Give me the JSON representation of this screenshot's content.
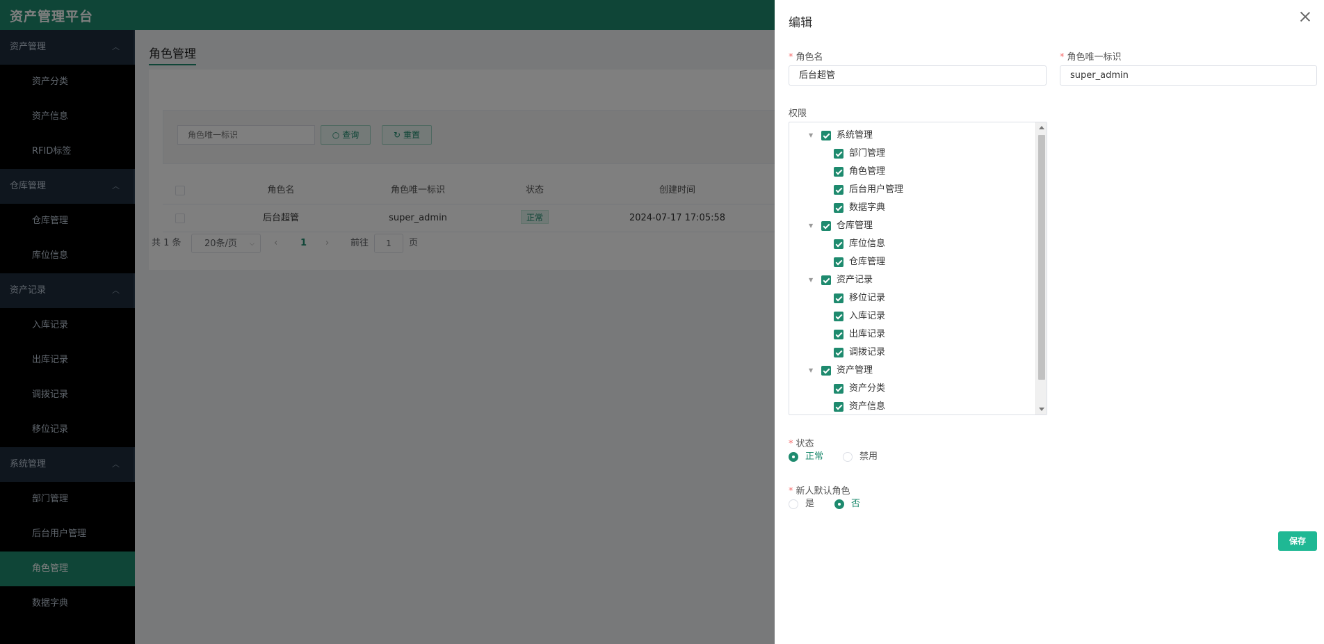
{
  "app": {
    "title": "资产管理平台"
  },
  "sidebar": {
    "groups": [
      {
        "label": "资产管理",
        "items": [
          "资产分类",
          "资产信息",
          "RFID标签"
        ]
      },
      {
        "label": "仓库管理",
        "items": [
          "仓库管理",
          "库位信息"
        ]
      },
      {
        "label": "资产记录",
        "items": [
          "入库记录",
          "出库记录",
          "调拨记录",
          "移位记录"
        ]
      },
      {
        "label": "系统管理",
        "items": [
          "部门管理",
          "后台用户管理",
          "角色管理",
          "数据字典"
        ]
      }
    ],
    "active": "角色管理"
  },
  "page": {
    "title": "角色管理",
    "search": {
      "placeholder": "角色唯一标识",
      "query_label": "查询",
      "reset_label": "重置"
    },
    "table": {
      "headers": [
        "角色名",
        "角色唯一标识",
        "状态",
        "创建时间"
      ],
      "rows": [
        {
          "name": "后台超管",
          "key": "super_admin",
          "status": "正常",
          "created": "2024-07-17 17:05:58"
        }
      ]
    },
    "pagination": {
      "total": "共 1 条",
      "page_size": "20条/页",
      "current": "1",
      "goto_prefix": "前往",
      "goto_value": "1",
      "goto_suffix": "页"
    }
  },
  "drawer": {
    "title": "编辑",
    "role_name_label": "角色名",
    "role_name_value": "后台超管",
    "role_key_label": "角色唯一标识",
    "role_key_value": "super_admin",
    "permission_label": "权限",
    "tree": [
      {
        "label": "系统管理",
        "level": 0
      },
      {
        "label": "部门管理",
        "level": 1
      },
      {
        "label": "角色管理",
        "level": 1
      },
      {
        "label": "后台用户管理",
        "level": 1
      },
      {
        "label": "数据字典",
        "level": 1
      },
      {
        "label": "仓库管理",
        "level": 0
      },
      {
        "label": "库位信息",
        "level": 1
      },
      {
        "label": "仓库管理",
        "level": 1
      },
      {
        "label": "资产记录",
        "level": 0
      },
      {
        "label": "移位记录",
        "level": 1
      },
      {
        "label": "入库记录",
        "level": 1
      },
      {
        "label": "出库记录",
        "level": 1
      },
      {
        "label": "调拨记录",
        "level": 1
      },
      {
        "label": "资产管理",
        "level": 0
      },
      {
        "label": "资产分类",
        "level": 1
      },
      {
        "label": "资产信息",
        "level": 1
      }
    ],
    "status_label": "状态",
    "status_options": [
      "正常",
      "禁用"
    ],
    "status_selected": "正常",
    "default_role_label": "新人默认角色",
    "default_role_options": [
      "是",
      "否"
    ],
    "default_role_selected": "否",
    "save_label": "保存"
  },
  "colors": {
    "accent": "#1e8a6e",
    "save": "#1fb894",
    "sidebar_bg": "#000000",
    "group_bg": "#1f2d3d"
  }
}
